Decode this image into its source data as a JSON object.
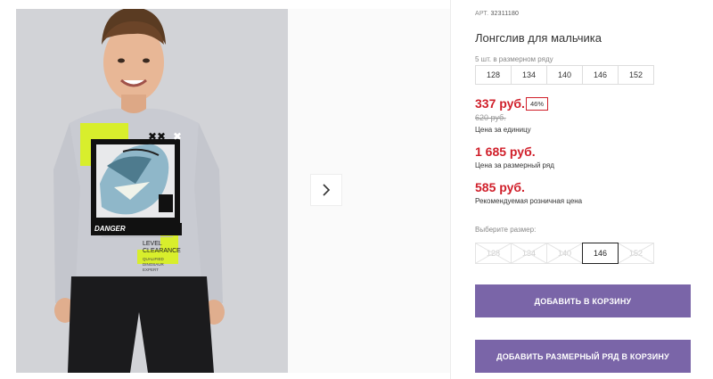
{
  "product": {
    "article_label": "АРТ.",
    "article": "32311180",
    "title": "Лонгслив для мальчика"
  },
  "range": {
    "label": "5 шт. в размерном ряду",
    "sizes": [
      "128",
      "134",
      "140",
      "146",
      "152"
    ]
  },
  "price": {
    "current": "337 руб.",
    "discount": "46%",
    "old": "620 руб.",
    "unit_label": "Цена за единицу"
  },
  "range_price": {
    "value": "1 685 руб.",
    "label": "Цена за размерный ряд"
  },
  "rrp": {
    "value": "585 руб.",
    "label": "Рекомендуемая розничная цена"
  },
  "size_select": {
    "label": "Выберите размер:",
    "options": [
      "128",
      "134",
      "140",
      "146",
      "152"
    ],
    "selected": "146"
  },
  "buttons": {
    "add_to_cart": "ДОБАВИТЬ В КОРЗИНУ",
    "add_range_to_cart": "ДОБАВИТЬ РАЗМЕРНЫЙ РЯД В КОРЗИНУ"
  },
  "shirt_print": {
    "danger": "DANGER",
    "level": "LEVEL",
    "clearance": "CLEARANCE",
    "small1": "QUALIFIED",
    "small2": "DINOSAUR",
    "small3": "EXPERT"
  },
  "icons": {
    "next": "chevron-right-icon"
  },
  "colors": {
    "price": "#d01f2a",
    "button": "#7a65a8"
  }
}
